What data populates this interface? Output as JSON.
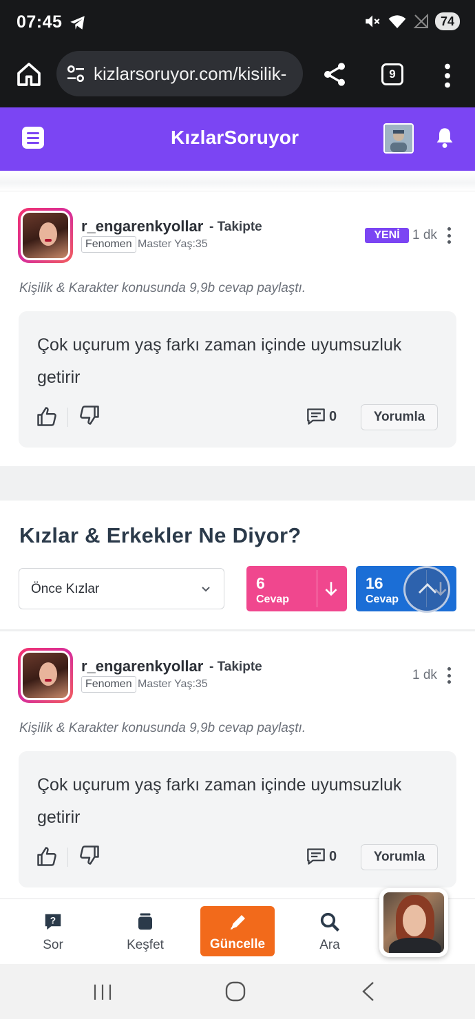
{
  "status_bar": {
    "time": "07:45",
    "battery": "74"
  },
  "browser": {
    "url": "kizlarsoruyor.com/kisilik-",
    "tab_count": "9"
  },
  "app_header": {
    "logo": "KızlarSoruyor"
  },
  "answers": [
    {
      "username": "r_engarenkyollar",
      "follow": "- Takipte",
      "badge": "Fenomen",
      "meta": "Master Yaş:35",
      "new_badge": "YENİ",
      "time_ago": "1 dk",
      "topic_line": "Kişilik & Karakter konusunda 9,9b cevap paylaştı.",
      "text": "Çok uçurum yaş farkı zaman içinde uyumsuzluk getirir",
      "comment_count": "0",
      "reply_label": "Yorumla"
    },
    {
      "username": "r_engarenkyollar",
      "follow": "- Takipte",
      "badge": "Fenomen",
      "meta": "Master Yaş:35",
      "time_ago": "1 dk",
      "topic_line": "Kişilik & Karakter konusunda 9,9b cevap paylaştı.",
      "text": "Çok uçurum yaş farkı zaman içinde uyumsuzluk getirir",
      "comment_count": "0",
      "reply_label": "Yorumla"
    }
  ],
  "section": {
    "title": "Kızlar & Erkekler Ne Diyor?",
    "sort_selected": "Önce Kızlar",
    "girls": {
      "count": "6",
      "label": "Cevap",
      "color": "#f0478e"
    },
    "boys": {
      "count": "16",
      "label": "Cevap",
      "color": "#1b6ed6"
    }
  },
  "bottom_nav": {
    "items": [
      {
        "label": "Sor",
        "icon": "question-bubble-icon"
      },
      {
        "label": "Keşfet",
        "icon": "cards-icon"
      },
      {
        "label": "Güncelle",
        "icon": "pencil-icon"
      },
      {
        "label": "Ara",
        "icon": "search-icon"
      }
    ]
  },
  "colors": {
    "brand": "#7b45f3",
    "update": "#f26a1b"
  }
}
